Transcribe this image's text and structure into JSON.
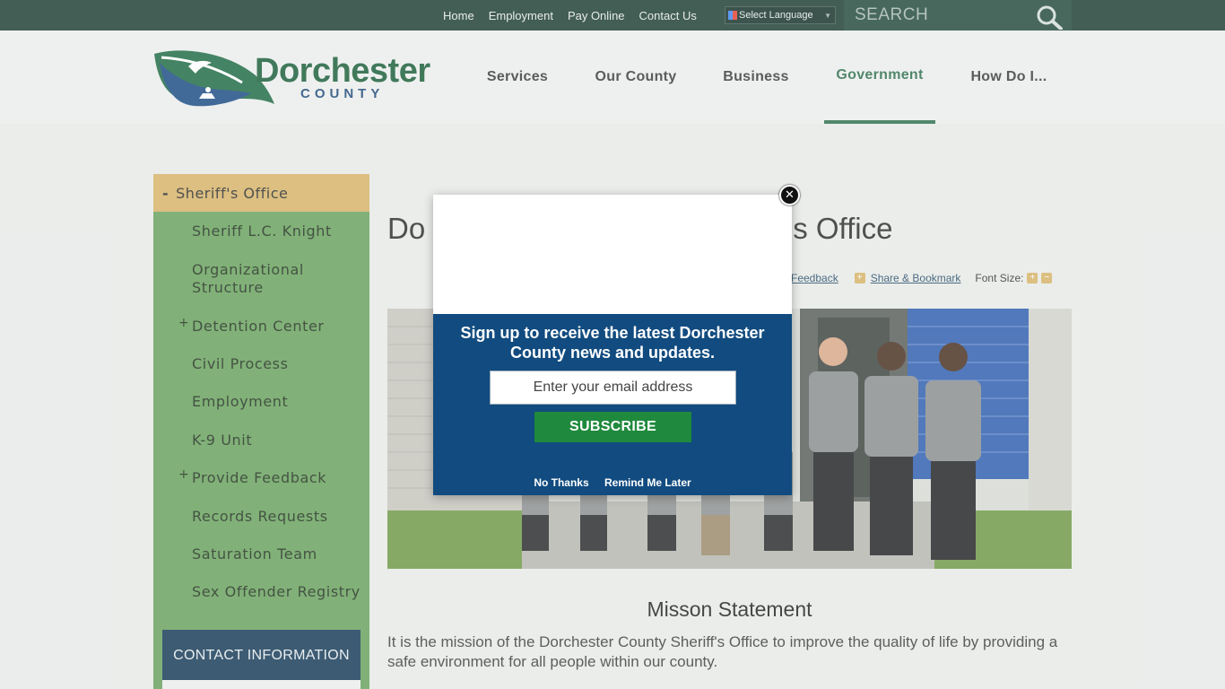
{
  "top_links": [
    "Home",
    "Employment",
    "Pay Online",
    "Contact Us"
  ],
  "language": {
    "label": "Select Language"
  },
  "search": {
    "placeholder": "SEARCH"
  },
  "logo": {
    "name": "Dorchester",
    "sub": "COUNTY"
  },
  "nav": [
    {
      "label": "Services"
    },
    {
      "label": "Our County"
    },
    {
      "label": "Business"
    },
    {
      "label": "Government",
      "active": true
    },
    {
      "label": "How Do I..."
    }
  ],
  "sidebar": {
    "heading": "Sheriff's Office",
    "items": [
      {
        "label": "Sheriff L.C. Knight"
      },
      {
        "label": "Organizational Structure"
      },
      {
        "label": "Detention Center",
        "expandable": true
      },
      {
        "label": "Civil Process"
      },
      {
        "label": "Employment"
      },
      {
        "label": "K-9 Unit"
      },
      {
        "label": "Provide Feedback",
        "expandable": true
      },
      {
        "label": "Records Requests"
      },
      {
        "label": "Saturation Team"
      },
      {
        "label": "Sex Offender Registry"
      }
    ],
    "contact_heading": "CONTACT INFORMATION"
  },
  "main": {
    "title_left": "Do",
    "title_right": "s Office",
    "tools": {
      "feedback": "Feedback",
      "share": "Share & Bookmark",
      "font_size": "Font Size:"
    },
    "mission_title": "Misson Statement",
    "mission_text": "It is the mission of the Dorchester County Sheriff's Office to improve the quality of life by providing a safe environment for all people within our county."
  },
  "modal": {
    "heading": "Sign up to receive the latest Dorchester County news and updates.",
    "email_placeholder": "Enter your email address",
    "subscribe_label": "SUBSCRIBE",
    "no_thanks": "No Thanks",
    "remind_later": "Remind Me Later"
  },
  "colors": {
    "topbar": "#1e3d33",
    "sidebar": "#6aa35f",
    "sidebar_active": "#d8b46a",
    "modal_blue": "#114b7f",
    "subscribe_green": "#1f8a3d",
    "nav_active": "#2f6f4f"
  }
}
